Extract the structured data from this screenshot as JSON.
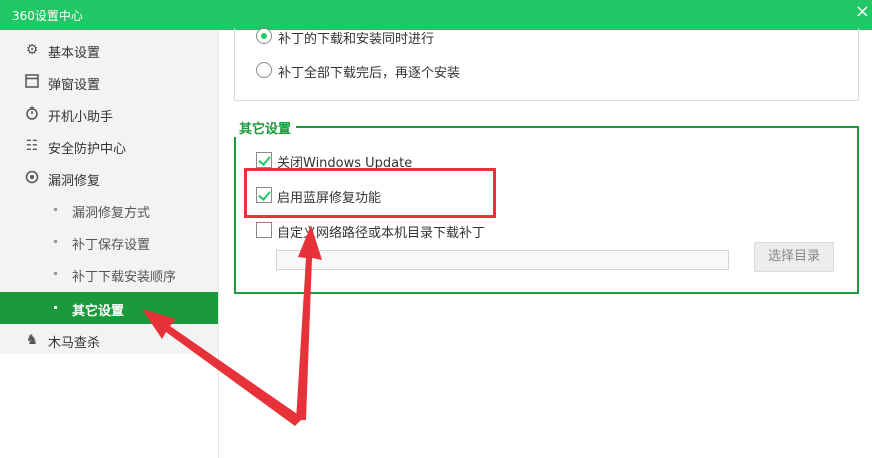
{
  "window": {
    "title": "360设置中心",
    "close_glyph": "×"
  },
  "sidebar": {
    "items": [
      {
        "label": "基本设置",
        "icon": "gear-icon"
      },
      {
        "label": "弹窗设置",
        "icon": "window-icon"
      },
      {
        "label": "开机小助手",
        "icon": "timer-icon"
      },
      {
        "label": "安全防护中心",
        "icon": "shield-grid-icon"
      },
      {
        "label": "漏洞修复",
        "icon": "patch-icon"
      }
    ],
    "sub_items": [
      {
        "label": "漏洞修复方式",
        "active": false
      },
      {
        "label": "补丁保存设置",
        "active": false
      },
      {
        "label": "补丁下载安装顺序",
        "active": false
      },
      {
        "label": "其它设置",
        "active": true
      }
    ],
    "after_items": [
      {
        "label": "木马查杀",
        "icon": "horse-icon"
      }
    ]
  },
  "install_order": {
    "options": [
      {
        "label": "补丁的下载和安装同时进行",
        "selected": true
      },
      {
        "label": "补丁全部下载完后，再逐个安装",
        "selected": false
      }
    ]
  },
  "other_settings": {
    "title": "其它设置",
    "options": [
      {
        "label": "关闭Windows Update",
        "checked": true
      },
      {
        "label": "启用蓝屏修复功能",
        "checked": true
      },
      {
        "label": "自定义网络路径或本机目录下载补丁",
        "checked": false
      }
    ],
    "path_value": "",
    "choose_dir_label": "选择目录"
  },
  "annotation_color": "#e8323a",
  "accent_color": "#1fc765"
}
